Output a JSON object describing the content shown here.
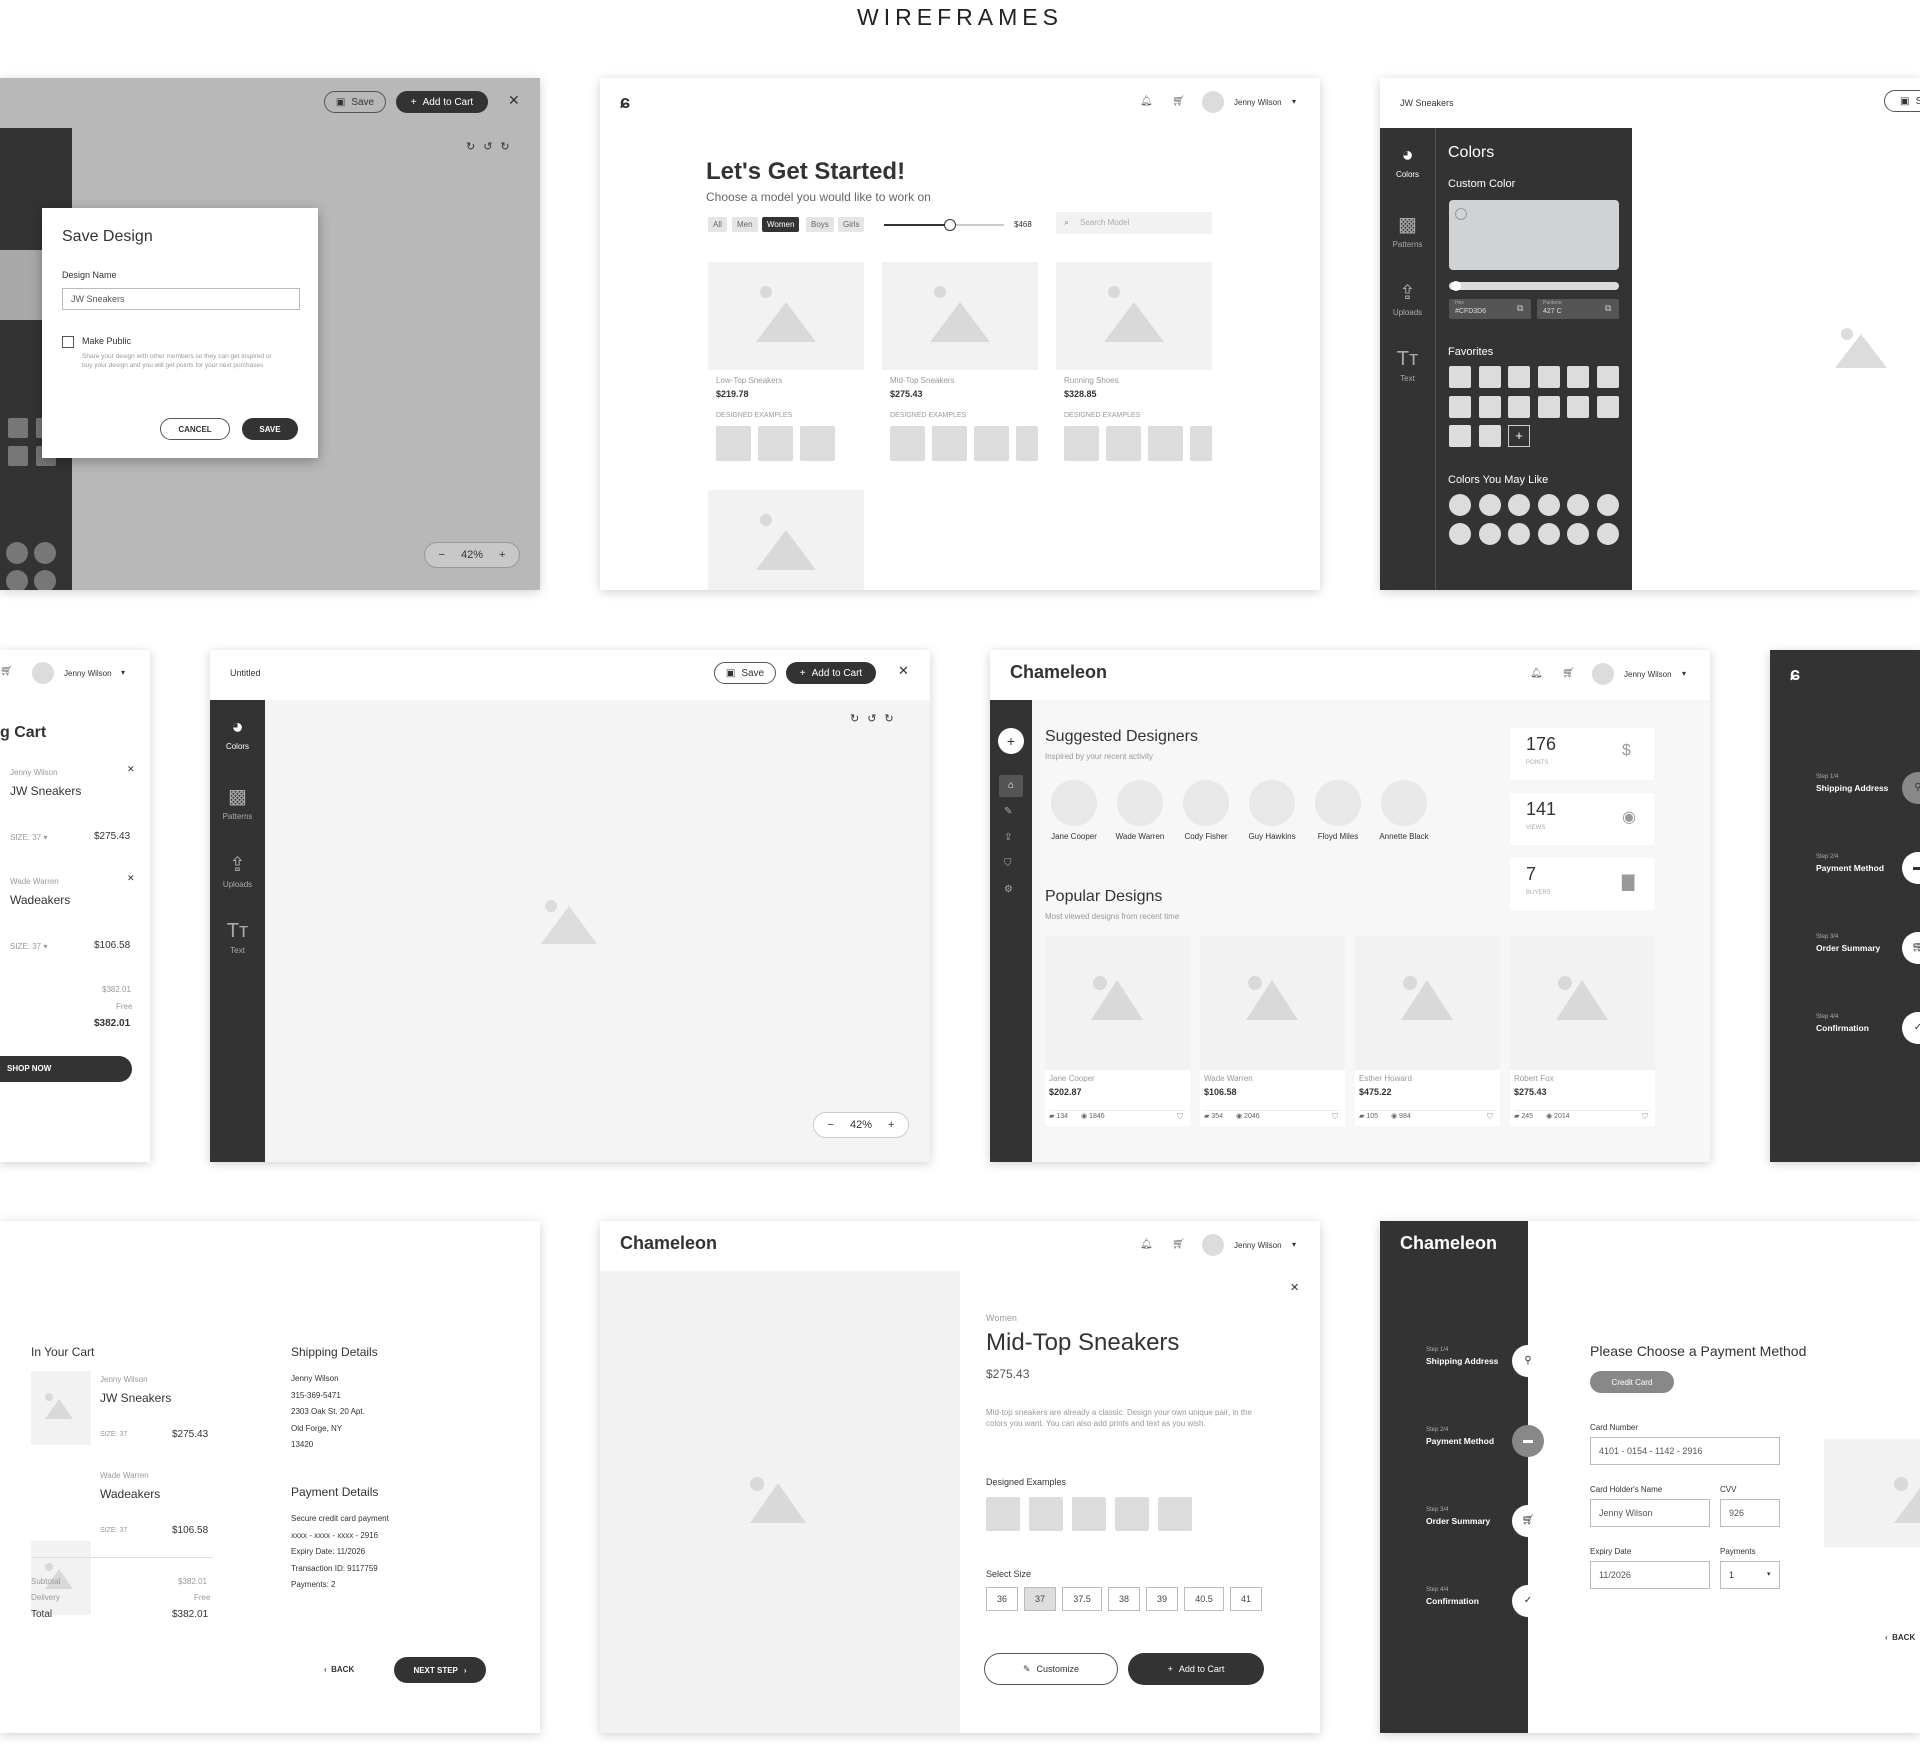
{
  "page": {
    "title": "WIREFRAMES"
  },
  "common": {
    "user_name": "Jenny Wilson",
    "brand": "Chameleon",
    "save": "Save",
    "add_to_cart": "Add to Cart",
    "zoom": "42%",
    "colors": "Colors",
    "patterns": "Patterns",
    "uploads": "Uploads",
    "text": "Text"
  },
  "save_design": {
    "title": "Save Design",
    "design_name_label": "Design Name",
    "design_name_value": "JW Sneakers",
    "make_public": "Make Public",
    "hint": "Share your design with other members so they can get inspired or buy your design and you will get points for your next purchases",
    "cancel": "CANCEL",
    "save": "SAVE"
  },
  "get_started": {
    "title": "Let's Get Started!",
    "subtitle": "Choose a model you would like to work on",
    "filters": [
      "All",
      "Men",
      "Women",
      "Boys",
      "Girls"
    ],
    "active_filter": "Women",
    "price": "$468",
    "search_placeholder": "Search Model",
    "designed_examples": "DESIGNED EXAMPLES",
    "products": [
      {
        "name": "Low-Top Sneakers",
        "price": "$219.78"
      },
      {
        "name": "Mid-Top Sneakers",
        "price": "$275.43"
      },
      {
        "name": "Running Shoes",
        "price": "$328.85"
      }
    ]
  },
  "colors_panel": {
    "doc_title": "JW Sneakers",
    "save_partial": "Sa",
    "heading": "Colors",
    "custom_color": "Custom Color",
    "hex_label": "Hex",
    "hex_value": "#CFD3D6",
    "pantone_label": "Pantone",
    "pantone_value": "427 C",
    "favorites": "Favorites",
    "may_like": "Colors You May Like"
  },
  "cart_side": {
    "title": "g Cart",
    "items": [
      {
        "designer": "Jenny Wilson",
        "name": "JW Sneakers",
        "size": "SIZE: 37",
        "price": "$275.43"
      },
      {
        "designer": "Wade Warren",
        "name": "Wadeakers",
        "size": "SIZE: 37",
        "price": "$106.58"
      }
    ],
    "subtotal": "$382.01",
    "delivery": "Free",
    "total": "$382.01",
    "shop_now": "SHOP NOW"
  },
  "editor": {
    "doc_title": "Untitled"
  },
  "dashboard": {
    "suggested_title": "Suggested Designers",
    "suggested_sub": "Inspired by your recent activity",
    "designers": [
      "Jane Cooper",
      "Wade Warren",
      "Cody Fisher",
      "Guy Hawkins",
      "Floyd Miles",
      "Annette Black"
    ],
    "stats": [
      {
        "value": "176",
        "label": "POINTS"
      },
      {
        "value": "141",
        "label": "VIEWS"
      },
      {
        "value": "7",
        "label": "BUYERS"
      }
    ],
    "popular_title": "Popular Designs",
    "popular_sub": "Most viewed designs from recent time",
    "designs": [
      {
        "designer": "Jane Cooper",
        "price": "$202.87",
        "buys": "134",
        "views": "1846"
      },
      {
        "designer": "Wade Warren",
        "price": "$106.58",
        "buys": "354",
        "views": "2046"
      },
      {
        "designer": "Esther Howard",
        "price": "$475.22",
        "buys": "105",
        "views": "984"
      },
      {
        "designer": "Robert Fox",
        "price": "$275.43",
        "buys": "245",
        "views": "2014"
      }
    ]
  },
  "steps": [
    {
      "step": "Step 1/4",
      "label": "Shipping Address"
    },
    {
      "step": "Step 2/4",
      "label": "Payment Method"
    },
    {
      "step": "Step 3/4",
      "label": "Order Summary"
    },
    {
      "step": "Step 4/4",
      "label": "Confirmation"
    }
  ],
  "summary": {
    "in_cart": "In Your Cart",
    "items": [
      {
        "designer": "Jenny Wilson",
        "name": "JW Sneakers",
        "size": "SIZE: 37",
        "price": "$275.43"
      },
      {
        "designer": "Wade Warren",
        "name": "Wadeakers",
        "size": "SIZE: 37",
        "price": "$106.58"
      }
    ],
    "subtotal_label": "Subtotal",
    "subtotal": "$382.01",
    "delivery_label": "Delivery",
    "delivery": "Free",
    "total_label": "Total",
    "total": "$382.01",
    "shipping_title": "Shipping Details",
    "shipping_lines": [
      "Jenny Wilson",
      "315-369-5471",
      "2303  Oak St. 20 Apt.",
      "Old Forge, NY",
      "13420"
    ],
    "payment_title": "Payment Details",
    "payment_lines": [
      "Secure credit card payment",
      "xxxx - xxxx - xxxx - 2916",
      "Expiry Date: 11/2026",
      "Transaction ID: 9117759",
      "Payments: 2"
    ],
    "back": "BACK",
    "next": "NEXT STEP"
  },
  "product": {
    "category": "Women",
    "name": "Mid-Top Sneakers",
    "price": "$275.43",
    "description": "Mid-top sneakers are already a classic. Design your own unique pair, in the colors you want. You can also add prints and text as you wish.",
    "designed_examples": "Designed Examples",
    "select_size": "Select Size",
    "sizes": [
      "36",
      "37",
      "37.5",
      "38",
      "39",
      "40.5",
      "41"
    ],
    "selected_size": "37",
    "customize": "Customize",
    "add_to_cart": "Add to Cart"
  },
  "payment": {
    "title": "Please Choose a Payment Method",
    "method": "Credit Card",
    "card_number_label": "Card Number",
    "card_number": "4101 - 0154 - 1142 - 2916",
    "holder_label": "Card Holder's Name",
    "holder": "Jenny Wilson",
    "cvv_label": "CVV",
    "cvv": "926",
    "expiry_label": "Expiry Date",
    "expiry": "11/2026",
    "payments_label": "Payments",
    "payments": "1",
    "back_partial": "BACK"
  }
}
